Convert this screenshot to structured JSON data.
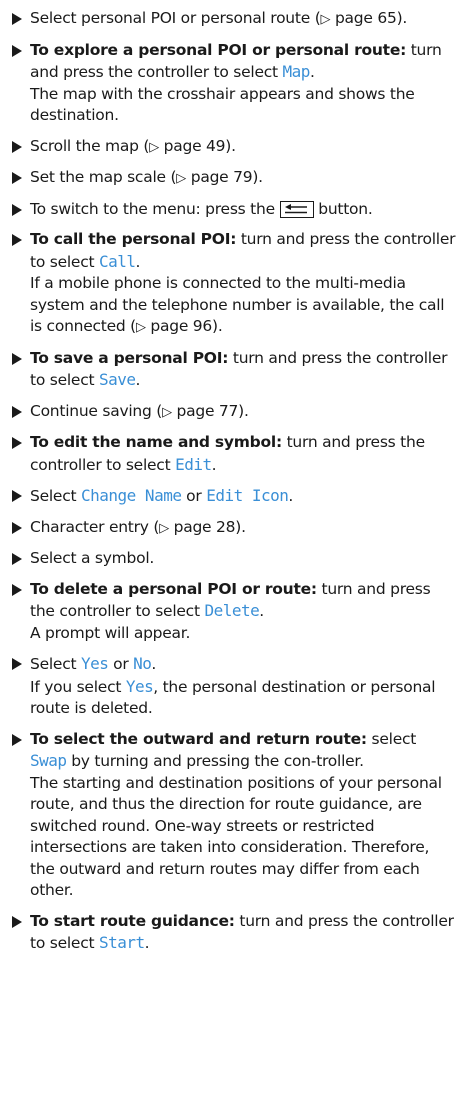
{
  "steps": {
    "s1": {
      "a": "Select personal POI or personal route",
      "ref": "page 65",
      "b": "."
    },
    "s2": {
      "lead": "To explore a personal POI or personal route:",
      "a": " turn and press the controller to select ",
      "ui": "Map",
      "b": ".",
      "result": "The map with the crosshair appears and shows the destination."
    },
    "s3": {
      "a": "Scroll the map",
      "ref": "page 49",
      "b": "."
    },
    "s4": {
      "a": "Set the map scale",
      "ref": "page 79",
      "b": "."
    },
    "s5": {
      "a": "To switch to the menu: press the ",
      "b": " button."
    },
    "s6": {
      "lead": "To call the personal POI:",
      "a": " turn and press the controller to select ",
      "ui": "Call",
      "b": ".",
      "result_a": "If a mobile phone is connected to the multi-media system and the telephone number is available, the call is connected",
      "ref": "page 96",
      "result_b": "."
    },
    "s7": {
      "lead": "To save a personal POI:",
      "a": " turn and press the controller to select ",
      "ui": "Save",
      "b": "."
    },
    "s8": {
      "a": "Continue saving",
      "ref": "page 77",
      "b": "."
    },
    "s9": {
      "lead": "To edit the name and symbol:",
      "a": " turn and press the controller to select ",
      "ui": "Edit",
      "b": "."
    },
    "s10": {
      "a": "Select ",
      "ui1": "Change Name",
      "mid": " or ",
      "ui2": "Edit Icon",
      "b": "."
    },
    "s11": {
      "a": "Character entry",
      "ref": "page 28",
      "b": "."
    },
    "s12": {
      "a": "Select a symbol."
    },
    "s13": {
      "lead": "To delete a personal POI or route:",
      "a": " turn and press the controller to select ",
      "ui": "Delete",
      "b": ".",
      "result": "A prompt will appear."
    },
    "s14": {
      "a": "Select ",
      "ui1": "Yes",
      "mid": " or ",
      "ui2": "No",
      "b": ".",
      "result_a": "If you select ",
      "result_ui": "Yes",
      "result_b": ", the personal destination or personal route is deleted."
    },
    "s15": {
      "lead": "To select the outward and return route:",
      "a": " select ",
      "ui": "Swap",
      "b": " by turning and pressing the con-troller.",
      "result": "The starting and destination positions of your personal route, and thus the direction for route guidance, are switched round. One-way streets or restricted intersections are taken into consideration. Therefore, the outward and return routes may differ from each other."
    },
    "s16": {
      "lead": "To start route guidance:",
      "a": " turn and press the controller to select ",
      "ui": "Start",
      "b": "."
    }
  },
  "ref_symbol": "▷",
  "icons": {
    "step_marker": "filled-triangle-right",
    "back_button": "back-arrow-key"
  }
}
